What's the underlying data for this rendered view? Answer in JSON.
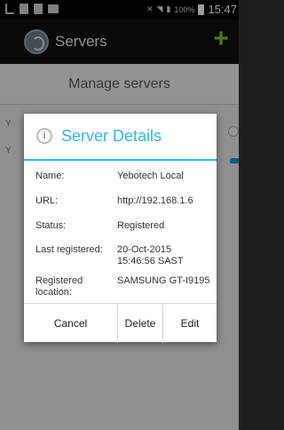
{
  "status_bar": {
    "battery": "100%",
    "time": "15:47"
  },
  "action_bar": {
    "title": "Servers",
    "add_icon": "plus-icon"
  },
  "screen": {
    "title": "Manage servers",
    "items": [
      {
        "partial_text": "Y"
      },
      {
        "partial_text": "Y"
      }
    ]
  },
  "dialog": {
    "icon": "info-icon",
    "title": "Server Details",
    "rows": [
      {
        "label": "Name:",
        "value": "Yebotech Local"
      },
      {
        "label": "URL:",
        "value": "http://192.168.1.6"
      },
      {
        "label": "Status:",
        "value": "Registered"
      },
      {
        "label": "Last registered:",
        "value": "20-Oct-2015 15:46:56 SAST"
      },
      {
        "label": "Registered location:",
        "value": "SAMSUNG GT-I9195"
      }
    ],
    "buttons": {
      "cancel": "Cancel",
      "delete": "Delete",
      "edit": "Edit"
    }
  },
  "colors": {
    "accent": "#33b5e5",
    "add": "#7ec427"
  }
}
